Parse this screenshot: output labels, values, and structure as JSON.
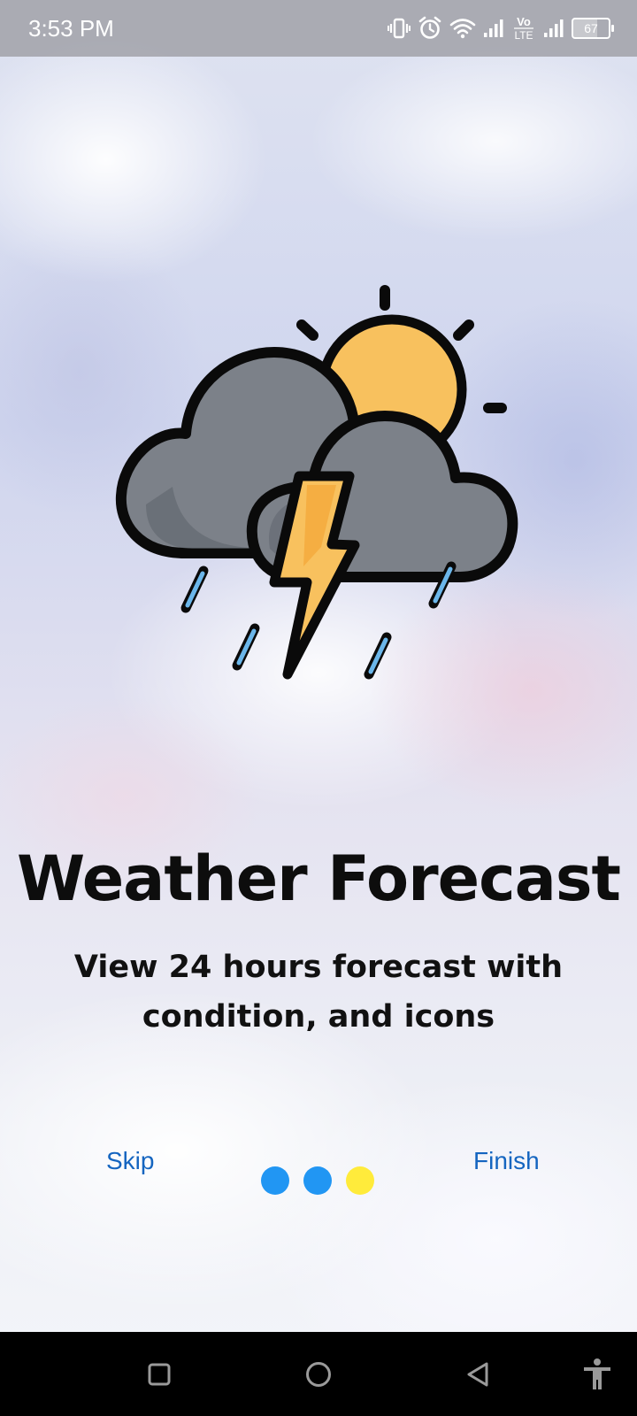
{
  "status_bar": {
    "time": "3:53 PM",
    "battery": "67",
    "icons": [
      "vibrate-icon",
      "alarm-icon",
      "wifi-icon",
      "signal-icon",
      "volte-icon",
      "signal-icon",
      "battery-icon"
    ],
    "volte_top": "Vo",
    "volte_bottom": "LTE"
  },
  "onboarding": {
    "title": "Weather Forecast",
    "subtitle": "View 24 hours forecast with condition, and icons",
    "illustration": "thunderstorm-sun-icon",
    "skip_label": "Skip",
    "finish_label": "Finish",
    "pager": {
      "count": 3,
      "current": 3,
      "active_color": "#FFEB3B",
      "inactive_color": "#2196F3"
    }
  },
  "nav_bar": {
    "buttons": [
      "recents-icon",
      "home-icon",
      "back-icon",
      "accessibility-icon"
    ]
  }
}
